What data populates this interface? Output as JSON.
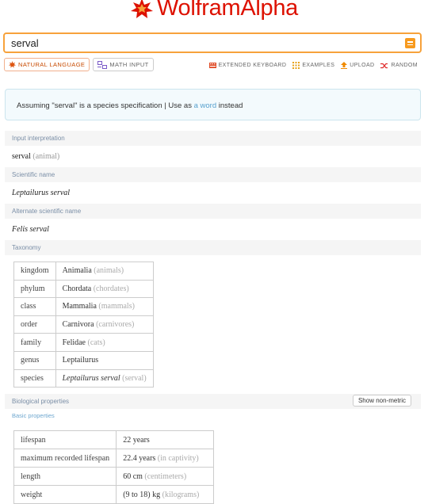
{
  "brand": {
    "wordmark": "WolframAlpha",
    "color": "#dd1100"
  },
  "search": {
    "value": "serval"
  },
  "modes": [
    {
      "label": "NATURAL LANGUAGE",
      "icon": "wolfram-star-icon",
      "active": true
    },
    {
      "label": "MATH INPUT",
      "icon": "math-input-icon",
      "active": false
    }
  ],
  "tools": [
    {
      "label": "EXTENDED KEYBOARD",
      "icon": "keyboard-icon"
    },
    {
      "label": "EXAMPLES",
      "icon": "grid-icon"
    },
    {
      "label": "UPLOAD",
      "icon": "upload-icon"
    },
    {
      "label": "RANDOM",
      "icon": "shuffle-icon"
    }
  ],
  "assumption": {
    "prefix": "Assuming \"serval\" is a species specification | Use as ",
    "link": "a word",
    "suffix": " instead"
  },
  "pods": {
    "input": {
      "title": "Input interpretation",
      "value": "serval",
      "qualifier": "(animal)"
    },
    "scientific": {
      "title": "Scientific name",
      "value": "Leptailurus serval"
    },
    "alternate": {
      "title": "Alternate scientific name",
      "value": "Felis serval"
    },
    "taxonomy": {
      "title": "Taxonomy",
      "rows": [
        {
          "rank": "kingdom",
          "name": "Animalia",
          "common": "(animals)"
        },
        {
          "rank": "phylum",
          "name": "Chordata",
          "common": "(chordates)"
        },
        {
          "rank": "class",
          "name": "Mammalia",
          "common": "(mammals)"
        },
        {
          "rank": "order",
          "name": "Carnivora",
          "common": "(carnivores)"
        },
        {
          "rank": "family",
          "name": "Felidae",
          "common": "(cats)"
        },
        {
          "rank": "genus",
          "name": "Leptailurus",
          "common": ""
        },
        {
          "rank": "species",
          "name": "Leptailurus serval",
          "common": "(serval)"
        }
      ]
    },
    "biological": {
      "title": "Biological properties",
      "button": "Show non-metric",
      "subtitle": "Basic properties",
      "rows": [
        {
          "prop": "lifespan",
          "value": "22 years",
          "note": ""
        },
        {
          "prop": "maximum recorded lifespan",
          "value": "22.4 years",
          "note": "(in captivity)"
        },
        {
          "prop": "length",
          "value": "60 cm",
          "note": "(centimeters)"
        },
        {
          "prop": "weight",
          "value": "(9 to 18) kg",
          "note": "(kilograms)"
        }
      ]
    }
  }
}
